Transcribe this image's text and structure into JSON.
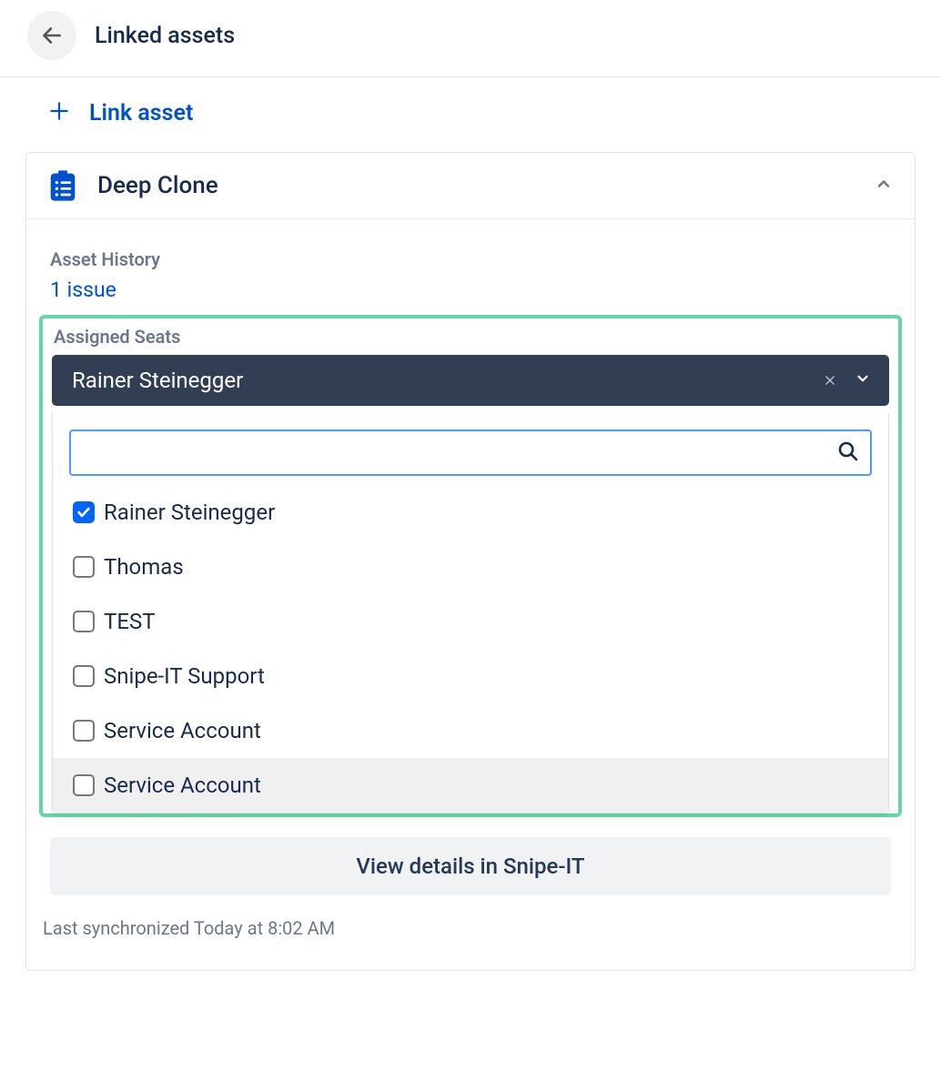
{
  "header": {
    "title": "Linked assets"
  },
  "link_asset": {
    "label": "Link asset"
  },
  "panel": {
    "title": "Deep Clone",
    "asset_history": {
      "label": "Asset History",
      "link": "1 issue"
    },
    "assigned_seats": {
      "label": "Assigned Seats",
      "selected": "Rainer Steinegger",
      "search_value": "",
      "options": [
        {
          "label": "Rainer Steinegger",
          "checked": true,
          "hovered": false
        },
        {
          "label": "Thomas",
          "checked": false,
          "hovered": false
        },
        {
          "label": "TEST",
          "checked": false,
          "hovered": false
        },
        {
          "label": "Snipe-IT Support",
          "checked": false,
          "hovered": false
        },
        {
          "label": "Service Account",
          "checked": false,
          "hovered": false
        },
        {
          "label": "Service Account",
          "checked": false,
          "hovered": true
        }
      ]
    },
    "view_details": "View details in Snipe-IT",
    "last_sync": "Last synchronized Today at 8:02 AM"
  }
}
